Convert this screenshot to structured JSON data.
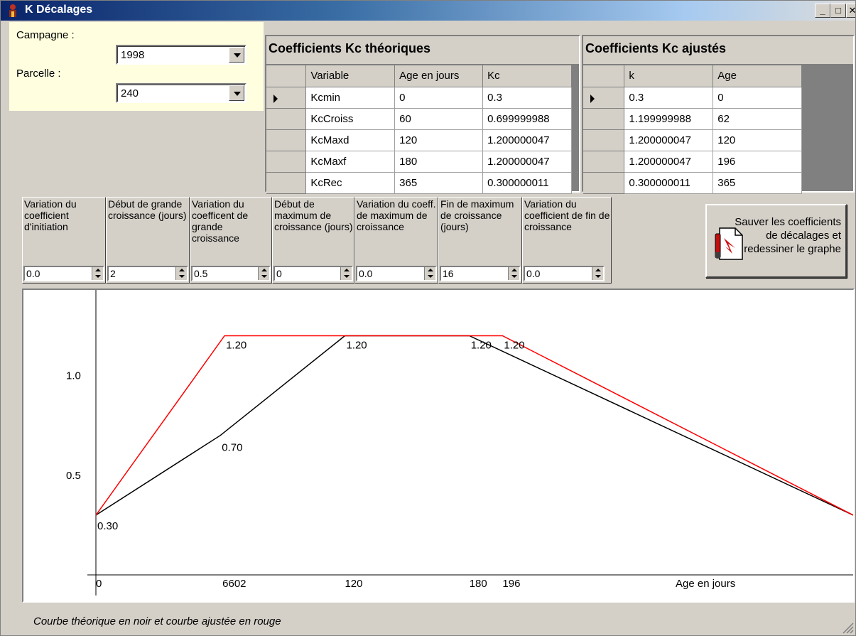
{
  "window": {
    "title": "K Décalages",
    "minimize": "_",
    "maximize": "□",
    "close": "✕"
  },
  "selectors": {
    "campagne_label": "Campagne :",
    "campagne_value": "1998",
    "parcelle_label": "Parcelle :",
    "parcelle_value": "240"
  },
  "theo_grid": {
    "title": "Coefficients Kc théoriques",
    "columns": [
      "Variable",
      "Age en jours",
      "Kc"
    ],
    "rows": [
      [
        "Kcmin",
        "0",
        "0.3"
      ],
      [
        "KcCroiss",
        "60",
        "0.699999988"
      ],
      [
        "KcMaxd",
        "120",
        "1.200000047"
      ],
      [
        "KcMaxf",
        "180",
        "1.200000047"
      ],
      [
        "KcRec",
        "365",
        "0.300000011"
      ]
    ]
  },
  "adj_grid": {
    "title": "Coefficients Kc ajustés",
    "columns": [
      "k",
      "Age"
    ],
    "rows": [
      [
        "0.3",
        "0"
      ],
      [
        "1.199999988",
        "62"
      ],
      [
        "1.200000047",
        "120"
      ],
      [
        "1.200000047",
        "196"
      ],
      [
        "0.300000011",
        "365"
      ]
    ]
  },
  "params": [
    {
      "label": "Variation du coefficient d'initiation",
      "value": "0.0"
    },
    {
      "label": "Début de grande croissance (jours)",
      "value": "2"
    },
    {
      "label": "Variation du coefficent de grande croissance",
      "value": "0.5"
    },
    {
      "label": "Début de maximum de croissance (jours)",
      "value": "0"
    },
    {
      "label": "Variation du coeff. de maximum de croissance",
      "value": "0.0"
    },
    {
      "label": "Fin de maximum de croissance (jours)",
      "value": "16"
    },
    {
      "label": "Variation du coefficient de fin de croissance",
      "value": "0.0"
    }
  ],
  "save_button": {
    "label": "Sauver les coefficients de décalages et redessiner le graphe"
  },
  "status_text": "Courbe théorique en noir et courbe ajustée en rouge",
  "chart_data": {
    "type": "line",
    "xlabel": "Age en jours",
    "ylabel": "",
    "xlim": [
      0,
      365
    ],
    "ylim": [
      0,
      1.43
    ],
    "y_ticks": [
      {
        "value": 0.5,
        "label": "0.5"
      },
      {
        "value": 1.0,
        "label": "1.0"
      }
    ],
    "x_tick_labels": [
      {
        "value": 0,
        "label": "0"
      },
      {
        "value": 61,
        "label": "6602"
      },
      {
        "value": 120,
        "label": "120"
      },
      {
        "value": 180,
        "label": "180"
      },
      {
        "value": 196,
        "label": "196"
      }
    ],
    "grid": false,
    "series": [
      {
        "color": "#000000",
        "points": [
          {
            "x": 0,
            "y": 0.3,
            "label": "0.30"
          },
          {
            "x": 60,
            "y": 0.7,
            "label": "0.70"
          },
          {
            "x": 120,
            "y": 1.2,
            "label": "1.20"
          },
          {
            "x": 180,
            "y": 1.2,
            "label": "1.20"
          },
          {
            "x": 365,
            "y": 0.3,
            "label": ""
          }
        ]
      },
      {
        "color": "#ff0000",
        "points": [
          {
            "x": 0,
            "y": 0.3,
            "label": ""
          },
          {
            "x": 62,
            "y": 1.2,
            "label": "1.20"
          },
          {
            "x": 120,
            "y": 1.2,
            "label": ""
          },
          {
            "x": 196,
            "y": 1.2,
            "label": "1.20"
          },
          {
            "x": 365,
            "y": 0.3,
            "label": ""
          }
        ]
      }
    ]
  }
}
